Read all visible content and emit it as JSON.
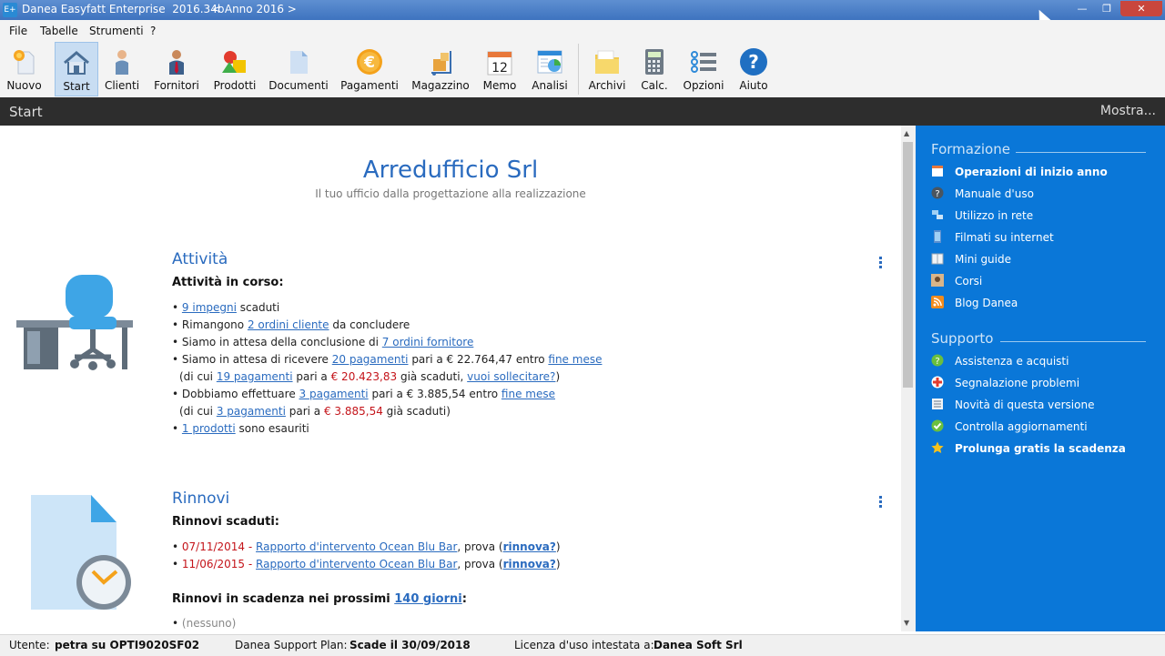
{
  "window": {
    "title": "Danea Easyfatt Enterprise  2016.34b",
    "year": "< Anno 2016 >",
    "minimize": "—",
    "maximize": "❐",
    "close": "✕",
    "app_icon": "E+"
  },
  "menu": [
    "File",
    "Tabelle",
    "Strumenti",
    "?"
  ],
  "toolbar": {
    "active": "Start",
    "items": [
      "Nuovo",
      "Start",
      "Clienti",
      "Fornitori",
      "Prodotti",
      "Documenti",
      "Pagamenti",
      "Magazzino",
      "Memo",
      "Analisi",
      "Archivi",
      "Calc.",
      "Opzioni",
      "Aiuto"
    ],
    "memo_icon_text": "12",
    "pagamenti_icon_text": "€",
    "aiuto_icon_text": "?"
  },
  "section_bar": {
    "title": "Start",
    "more": "Mostra..."
  },
  "company": {
    "name": "Arredufficio Srl",
    "tagline": "Il tuo ufficio dalla progettazione alla realizzazione"
  },
  "attivita": {
    "title": "Attività",
    "subtitle": "Attività in corso:",
    "l1_link": "9 impegni",
    "l1_rest": " scaduti",
    "l2_pre": "Rimangono ",
    "l2_link": "2 ordini cliente",
    "l2_rest": " da concludere",
    "l3_pre": "Siamo in attesa della conclusione di ",
    "l3_link": "7 ordini fornitore",
    "l4_pre": "Siamo in attesa di ricevere ",
    "l4_link": "20 pagamenti",
    "l4_mid": " pari a € 22.764,47 entro ",
    "l4_link2": "fine mese",
    "l5_pre": "(di cui ",
    "l5_link": "19 pagamenti",
    "l5_mid": " pari a ",
    "l5_amount": "€ 20.423,83",
    "l5_mid2": " già scaduti, ",
    "l5_link2": "vuoi sollecitare?",
    "l5_end": ")",
    "l6_pre": "Dobbiamo effettuare ",
    "l6_link": "3 pagamenti",
    "l6_mid": " pari a € 3.885,54 entro ",
    "l6_link2": "fine mese",
    "l7_pre": "(di cui ",
    "l7_link": "3 pagamenti",
    "l7_mid": " pari a ",
    "l7_amount": "€ 3.885,54",
    "l7_end": " già scaduti)",
    "l8_link": "1 prodotti",
    "l8_rest": " sono esauriti"
  },
  "rinnovi": {
    "title": "Rinnovi",
    "subtitle": "Rinnovi scaduti:",
    "rows": [
      {
        "date": "07/11/2014",
        "sep": " - ",
        "link": "Rapporto d'intervento Ocean Blu Bar",
        "mid": ", prova  (",
        "action": "rinnova?",
        "end": ")"
      },
      {
        "date": "11/06/2015",
        "sep": " - ",
        "link": "Rapporto d'intervento Ocean Blu Bar",
        "mid": ", prova  (",
        "action": "rinnova?",
        "end": ")"
      }
    ],
    "upcoming_pre": "Rinnovi in scadenza nei prossimi ",
    "upcoming_link": "140 giorni",
    "upcoming_end": ":",
    "none": "(nessuno)"
  },
  "sidebar": {
    "formazione": "Formazione",
    "formazione_items": [
      "Operazioni di inizio anno",
      "Manuale d'uso",
      "Utilizzo in rete",
      "Filmati su internet",
      "Mini guide",
      "Corsi",
      "Blog Danea"
    ],
    "supporto": "Supporto",
    "supporto_items": [
      "Assistenza e acquisti",
      "Segnalazione problemi",
      "Novità di questa versione",
      "Controlla aggiornamenti",
      "Prolunga gratis la scadenza"
    ]
  },
  "status": {
    "user_label": "Utente:",
    "user_value": "petra su OPTI9020SF02",
    "plan_label": "Danea Support Plan:",
    "plan_value": "Scade il 30/09/2018",
    "license_label": "Licenza d'uso intestata a:",
    "license_value": "Danea Soft Srl"
  },
  "colors": {
    "accent": "#2a6bbf",
    "sidebar": "#0a77d8",
    "alert": "#c4141a",
    "section_bar": "#2d2d2d"
  }
}
